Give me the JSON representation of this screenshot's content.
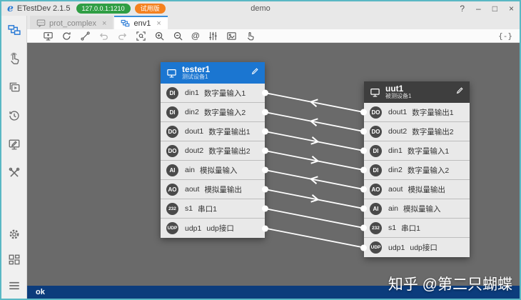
{
  "window": {
    "logo_letter": "e",
    "app_name": "ETestDev 2.1.5",
    "address_badge": "127.0.0.1:1210",
    "trial_badge": "试用版",
    "title": "demo",
    "controls": {
      "help": "?",
      "minimize": "–",
      "maximize": "□",
      "close": "×"
    }
  },
  "tabs": [
    {
      "label": "prot_complex",
      "icon": "chat-icon",
      "active": false,
      "close": "×"
    },
    {
      "label": "env1",
      "icon": "topology-icon",
      "active": true,
      "close": "×"
    }
  ],
  "toolbar": {
    "icons": [
      "monitor",
      "refresh",
      "connect",
      "undo",
      "redo",
      "fit-view",
      "zoom-in",
      "zoom-out",
      "at",
      "mixer",
      "image",
      "touch"
    ],
    "at_label": "@",
    "code_label": "{-}"
  },
  "sidebar": {
    "top_icons": [
      "topology",
      "touch",
      "run-layers",
      "history",
      "monitor-edit",
      "tools"
    ],
    "bottom_icons": [
      "settings-gear",
      "dashboard",
      "menu"
    ]
  },
  "devices": [
    {
      "id": "tester1",
      "title": "tester1",
      "subtitle": "测试设备1",
      "side": "right",
      "ports": [
        {
          "badge": "DI",
          "name": "din1",
          "desc": "数字量输入1"
        },
        {
          "badge": "DI",
          "name": "din2",
          "desc": "数字量输入2"
        },
        {
          "badge": "DO",
          "name": "dout1",
          "desc": "数字量输出1"
        },
        {
          "badge": "DO",
          "name": "dout2",
          "desc": "数字量输出2"
        },
        {
          "badge": "AI",
          "name": "ain",
          "desc": "模拟量输入"
        },
        {
          "badge": "AO",
          "name": "aout",
          "desc": "模拟量输出"
        },
        {
          "badge": "232",
          "name": "s1",
          "desc": "串口1"
        },
        {
          "badge": "UDP",
          "name": "udp1",
          "desc": "udp接口"
        }
      ]
    },
    {
      "id": "uut1",
      "title": "uut1",
      "subtitle": "被测设备1",
      "side": "left",
      "ports": [
        {
          "badge": "DO",
          "name": "dout1",
          "desc": "数字量输出1"
        },
        {
          "badge": "DO",
          "name": "dout2",
          "desc": "数字量输出2"
        },
        {
          "badge": "DI",
          "name": "din1",
          "desc": "数字量输入1"
        },
        {
          "badge": "DI",
          "name": "din2",
          "desc": "数字量输入2"
        },
        {
          "badge": "AO",
          "name": "aout",
          "desc": "模拟量输出"
        },
        {
          "badge": "AI",
          "name": "ain",
          "desc": "模拟量输入"
        },
        {
          "badge": "232",
          "name": "s1",
          "desc": "串口1"
        },
        {
          "badge": "UDP",
          "name": "udp1",
          "desc": "udp接口"
        }
      ]
    }
  ],
  "connections": [
    {
      "from": "uut1.dout1",
      "to": "tester1.din1",
      "arrow": true
    },
    {
      "from": "uut1.dout2",
      "to": "tester1.din2",
      "arrow": true
    },
    {
      "from": "tester1.dout1",
      "to": "uut1.din1",
      "arrow": true
    },
    {
      "from": "tester1.dout2",
      "to": "uut1.din2",
      "arrow": true
    },
    {
      "from": "uut1.aout",
      "to": "tester1.ain",
      "arrow": true
    },
    {
      "from": "tester1.aout",
      "to": "uut1.ain",
      "arrow": true
    },
    {
      "from": "tester1.s1",
      "to": "uut1.s1",
      "arrow": false
    },
    {
      "from": "tester1.udp1",
      "to": "uut1.udp1",
      "arrow": false
    }
  ],
  "status": {
    "text": "ok"
  },
  "watermark": "知乎 @第二只蝴蝶",
  "colors": {
    "accent_blue": "#1b76d1",
    "uut_header": "#3e3e3e",
    "canvas": "#6a6a6a",
    "status_bar": "#0c3c7c",
    "address_green": "#2f9e44",
    "trial_orange": "#f58220",
    "window_border": "#5ab8c4",
    "wire": "#ffffff"
  }
}
